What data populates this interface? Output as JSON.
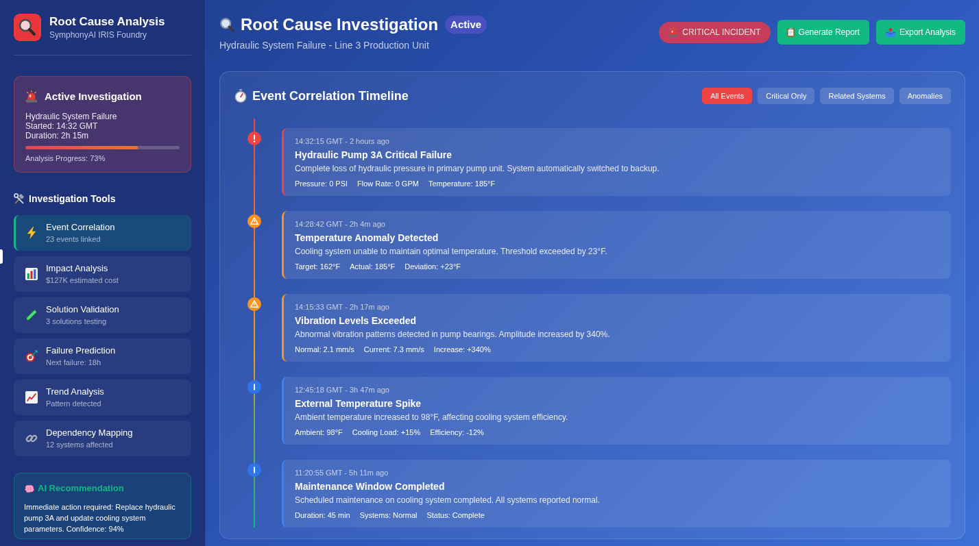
{
  "sidebar": {
    "brand": {
      "title": "Root Cause Analysis",
      "subtitle": "SymphonyAI IRIS Foundry"
    },
    "active_investigation": {
      "title": "Active Investigation",
      "lines": [
        "Hydraulic System Failure",
        "Started: 14:32 GMT",
        "Duration: 2h 15m"
      ],
      "level": 0.73,
      "progress_label": "Analysis Progress: 73%"
    },
    "tools_heading": "Investigation Tools",
    "tools": [
      {
        "title": "Event Correlation",
        "detail": "23 events linked",
        "selected": true
      },
      {
        "title": "Impact Analysis",
        "detail": "$127K estimated cost",
        "selected": false
      },
      {
        "title": "Solution Validation",
        "detail": "3 solutions testing",
        "selected": false
      },
      {
        "title": "Failure Prediction",
        "detail": "Next failure: 18h",
        "selected": false
      },
      {
        "title": "Trend Analysis",
        "detail": "Pattern detected",
        "selected": false
      },
      {
        "title": "Dependency Mapping",
        "detail": "12 systems affected",
        "selected": false
      }
    ],
    "recommendation": {
      "title": "AI Recommendation",
      "text": "Immediate action required: Replace hydraulic pump 3A and update cooling system parameters. Confidence: 94%"
    }
  },
  "header": {
    "title": "Root Cause Investigation",
    "status": "Active",
    "subtitle": "Hydraulic System Failure - Line 3 Production Unit",
    "actions": [
      {
        "label": "CRITICAL INCIDENT",
        "kind": "alert"
      },
      {
        "label": "Generate Report",
        "kind": "primary"
      },
      {
        "label": "Export Analysis",
        "kind": "primary"
      }
    ]
  },
  "timeline": {
    "title": "Event Correlation Timeline",
    "filters": [
      {
        "label": "All Events",
        "selected": true
      },
      {
        "label": "Critical Only",
        "selected": false
      },
      {
        "label": "Related Systems",
        "selected": false
      },
      {
        "label": "Anomalies",
        "selected": false
      }
    ],
    "events": [
      {
        "kind": "critical",
        "time": "14:32:15 GMT - 2 hours ago",
        "title": "Hydraulic Pump 3A Critical Failure",
        "description": "Complete loss of hydraulic pressure in primary pump unit. System automatically switched to backup.",
        "metrics": [
          "Pressure: 0 PSI",
          "Flow Rate: 0 GPM",
          "Temperature: 185°F"
        ]
      },
      {
        "kind": "warning",
        "time": "14:28:42 GMT - 2h 4m ago",
        "title": "Temperature Anomaly Detected",
        "description": "Cooling system unable to maintain optimal temperature. Threshold exceeded by 23°F.",
        "metrics": [
          "Target: 162°F",
          "Actual: 185°F",
          "Deviation: +23°F"
        ]
      },
      {
        "kind": "warning",
        "time": "14:15:33 GMT - 2h 17m ago",
        "title": "Vibration Levels Exceeded",
        "description": "Abnormal vibration patterns detected in pump bearings. Amplitude increased by 340%.",
        "metrics": [
          "Normal: 2.1 mm/s",
          "Current: 7.3 mm/s",
          "Increase: +340%"
        ]
      },
      {
        "kind": "info",
        "time": "12:45:18 GMT - 3h 47m ago",
        "title": "External Temperature Spike",
        "description": "Ambient temperature increased to 98°F, affecting cooling system efficiency.",
        "metrics": [
          "Ambient: 98°F",
          "Cooling Load: +15%",
          "Efficiency: -12%"
        ]
      },
      {
        "kind": "info",
        "time": "11:20:55 GMT - 5h 11m ago",
        "title": "Maintenance Window Completed",
        "description": "Scheduled maintenance on cooling system completed. All systems reported normal.",
        "metrics": [
          "Duration: 45 min",
          "Systems: Normal",
          "Status: Complete"
        ]
      }
    ]
  }
}
